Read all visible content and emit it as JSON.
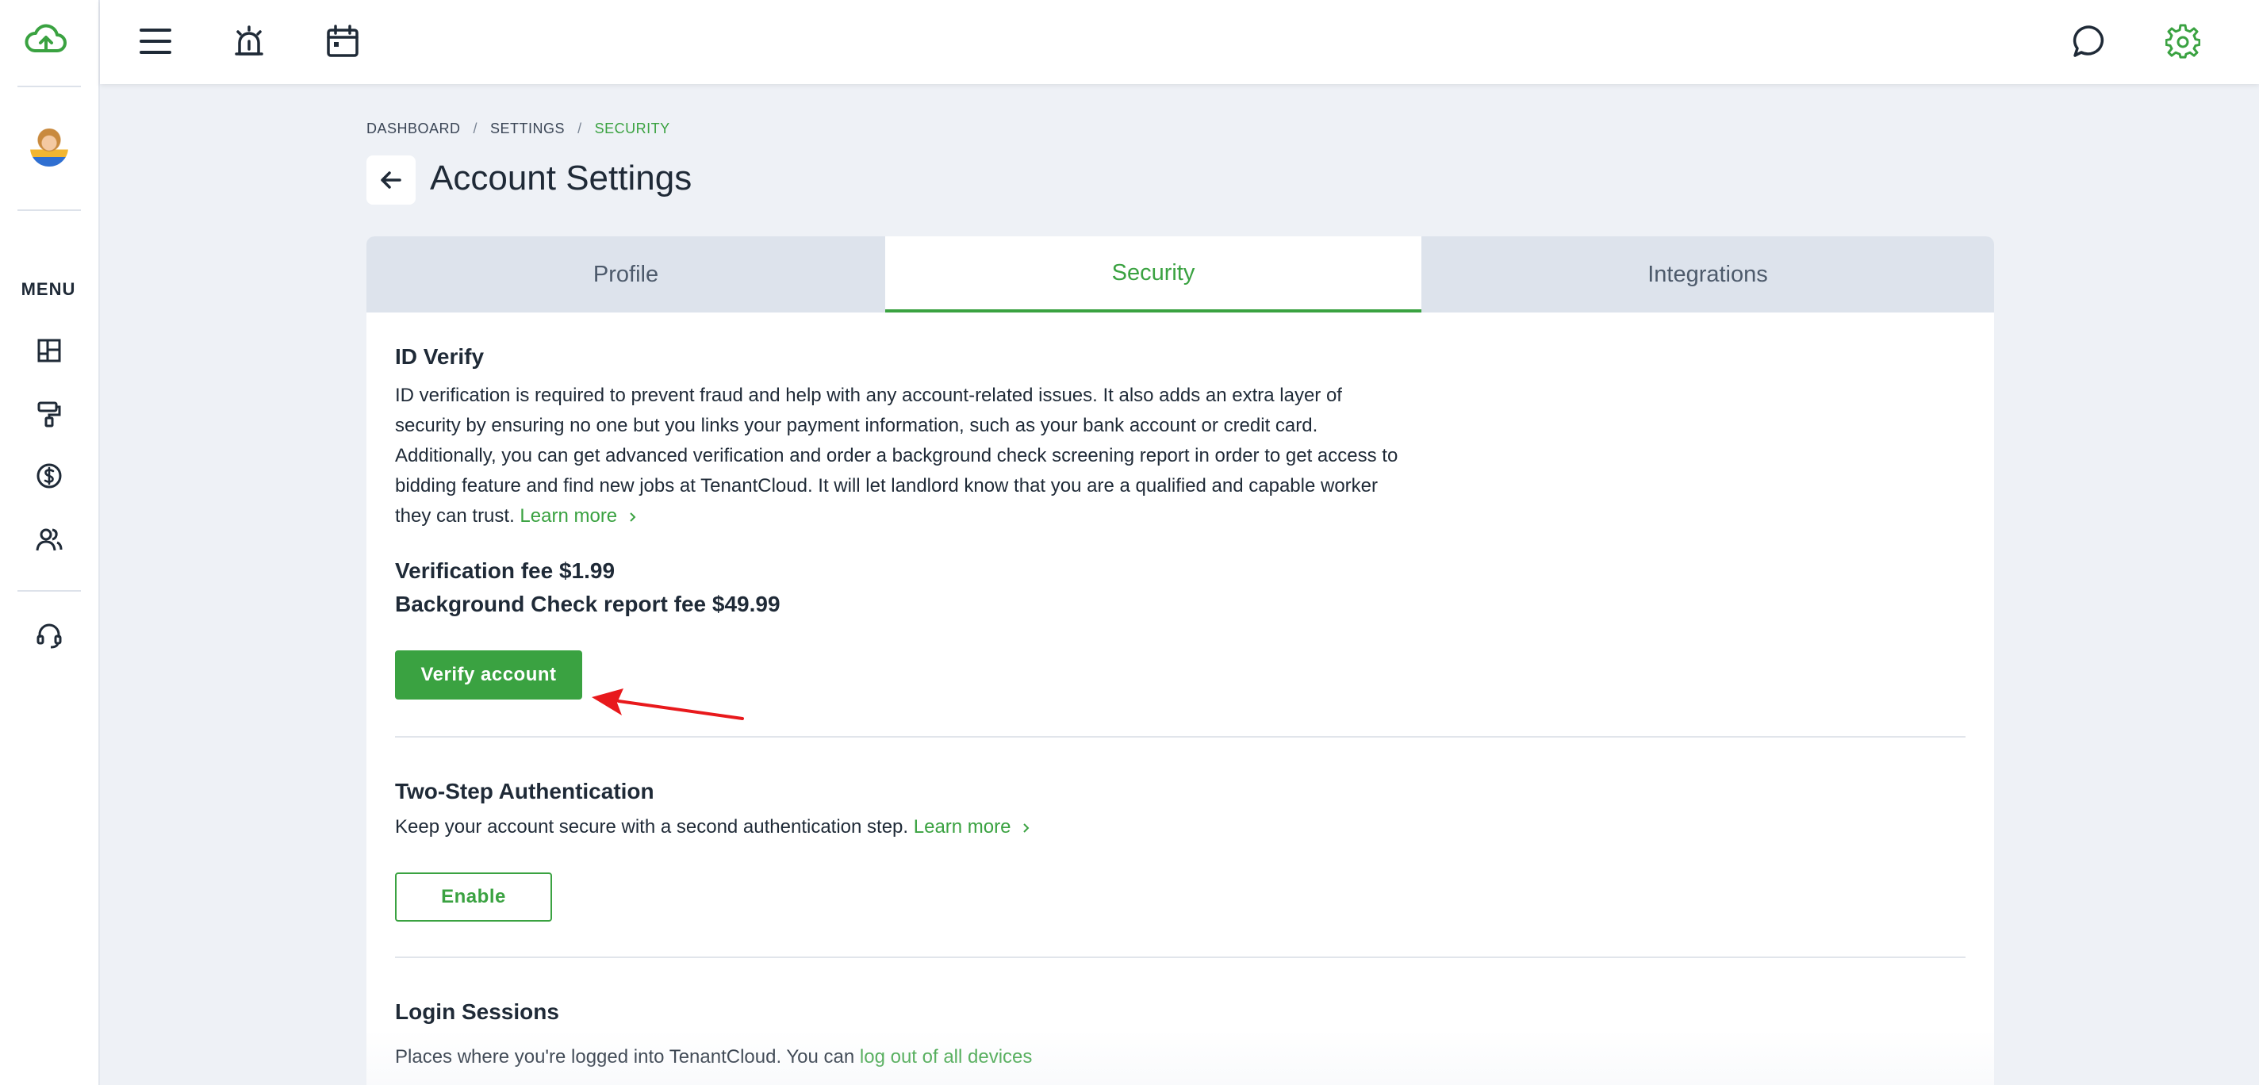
{
  "sidebar": {
    "logo_icon": "cloud-upload-icon",
    "avatar": "user-avatar",
    "menu_label": "MENU",
    "items": [
      {
        "icon": "dashboard-grid-icon"
      },
      {
        "icon": "paint-roller-icon"
      },
      {
        "icon": "dollar-circle-icon"
      },
      {
        "icon": "users-icon"
      },
      {
        "icon": "headset-support-icon"
      }
    ]
  },
  "topbar": {
    "left_icons": [
      "hamburger-menu-icon",
      "alarm-bell-icon",
      "calendar-icon"
    ],
    "right_icons": [
      "chat-bubble-icon",
      "settings-gear-icon"
    ]
  },
  "breadcrumb": {
    "items": [
      "DASHBOARD",
      "SETTINGS",
      "SECURITY"
    ],
    "separator": "/"
  },
  "page_title": "Account Settings",
  "tabs": [
    {
      "label": "Profile",
      "active": false
    },
    {
      "label": "Security",
      "active": true
    },
    {
      "label": "Integrations",
      "active": false
    }
  ],
  "id_verify": {
    "title": "ID Verify",
    "lines": [
      "ID verification is required to prevent fraud and help with any account-related issues. It also adds an extra layer of",
      "security by ensuring no one but you links your payment information, such as your bank account or credit card.",
      "Additionally, you can get advanced verification and order a background check screening report in order to get access to",
      "bidding feature and find new jobs at TenantCloud. It will let landlord know that you are a qualified and capable worker",
      "they can trust."
    ],
    "learn_more": "Learn more",
    "verification_fee": "Verification fee $1.99",
    "background_fee": "Background Check report fee $49.99",
    "button_label": "Verify account"
  },
  "two_step": {
    "title": "Two-Step Authentication",
    "description": "Keep your account secure with a second authentication step.",
    "learn_more": "Learn more",
    "button_label": "Enable"
  },
  "login_sessions": {
    "title": "Login Sessions",
    "description": "Places where you're logged into TenantCloud. You can",
    "logout_link": "log out of all devices"
  },
  "colors": {
    "brand_green": "#3aa241",
    "annotation_red": "#e8191c"
  }
}
